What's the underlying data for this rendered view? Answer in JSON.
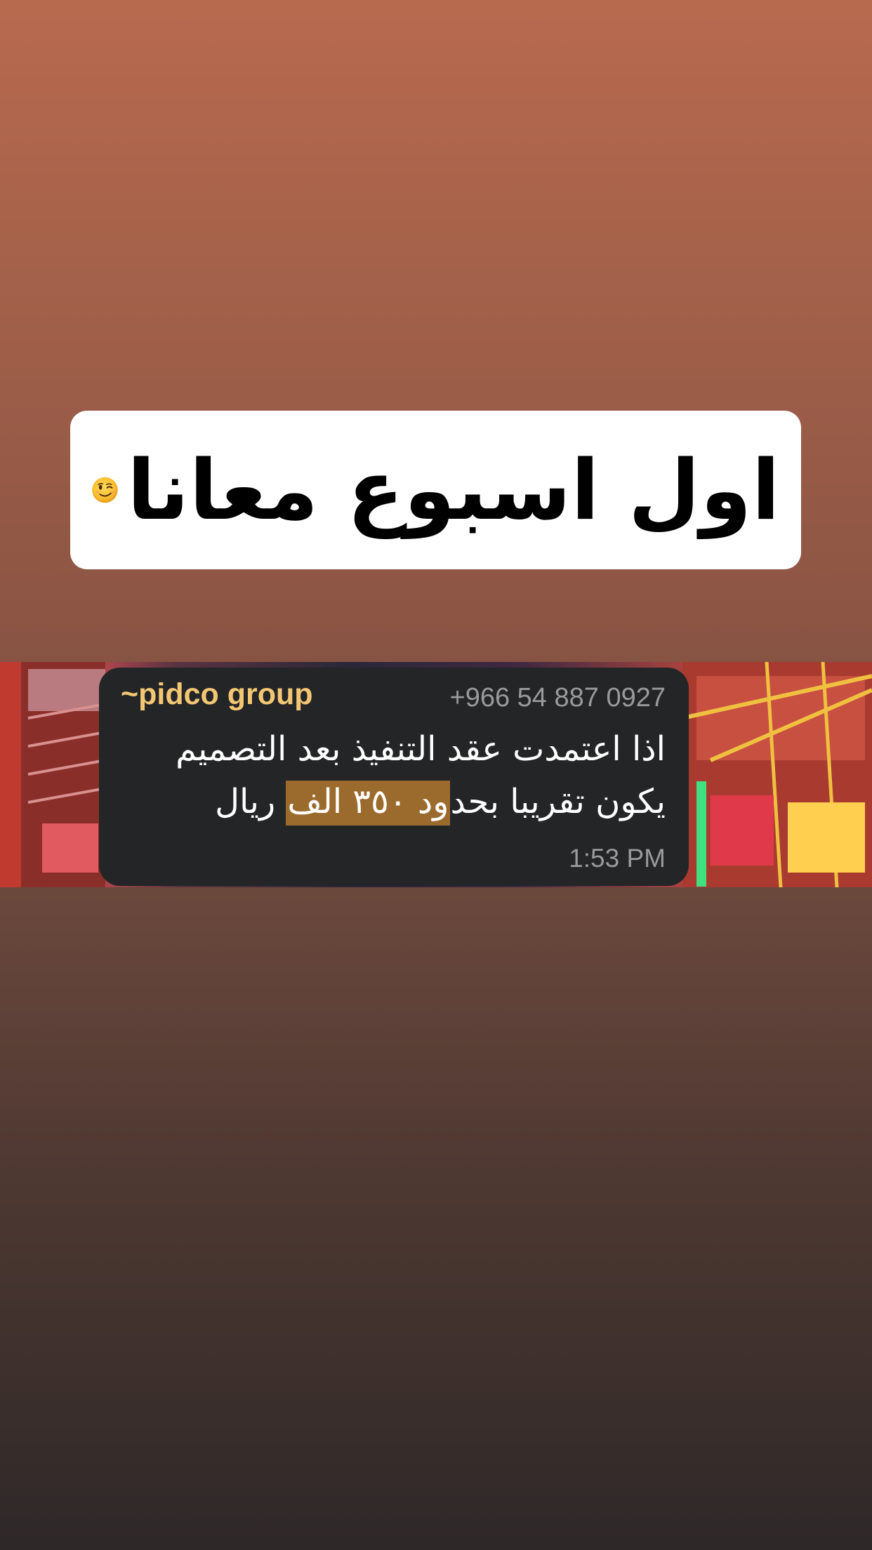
{
  "caption": {
    "text": "اول اسبوع معانا",
    "emoji": "winking-face-emoji"
  },
  "message": {
    "sender": "~pidco group",
    "phone": "+966 54 887 0927",
    "line1": "اذا اعتمدت عقد التنفيذ بعد التصميم",
    "line2_before": "يكون تقريبا بحد",
    "line2_highlight": "ود ٣٥٠ الف",
    "line2_after": " ريال",
    "time": "1:53 PM",
    "highlight_color": "#9b6b2d",
    "sender_color": "#f3c673",
    "bubble_color": "#232526"
  }
}
